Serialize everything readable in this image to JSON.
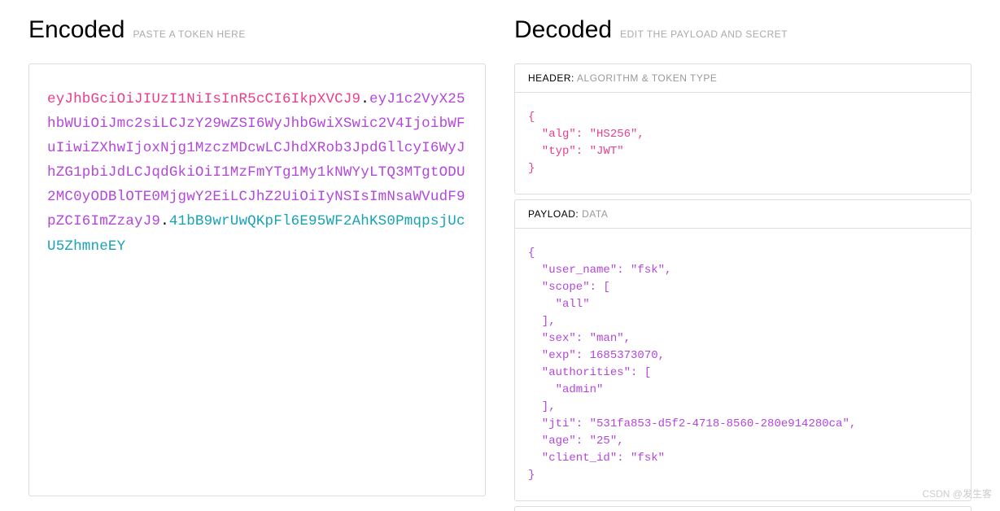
{
  "encoded": {
    "title": "Encoded",
    "subtitle": "PASTE A TOKEN HERE",
    "token": {
      "header": "eyJhbGciOiJIUzI1NiIsInR5cCI6IkpXVCJ9",
      "payload": "eyJ1c2VyX25hbWUiOiJmc2siLCJzY29wZSI6WyJhbGwiXSwic2V4IjoibWFuIiwiZXhwIjoxNjg1MzczMDcwLCJhdXRob3JpdGllcyI6WyJhZG1pbiJdLCJqdGkiOiI1MzFmYTg1My1kNWYyLTQ3MTgtODU2MC0yODBlOTE0MjgwY2EiLCJhZ2UiOiIyNSIsImNsaWVudF9pZCI6ImZzayJ9",
      "signature": "41bB9wrUwQKpFl6E95WF2AhKS0PmqpsjUcU5ZhmneEY"
    }
  },
  "decoded": {
    "title": "Decoded",
    "subtitle": "EDIT THE PAYLOAD AND SECRET",
    "header_section": {
      "label": "HEADER:",
      "sub": "ALGORITHM & TOKEN TYPE",
      "json": "{\n  \"alg\": \"HS256\",\n  \"typ\": \"JWT\"\n}"
    },
    "payload_section": {
      "label": "PAYLOAD:",
      "sub": "DATA",
      "json": "{\n  \"user_name\": \"fsk\",\n  \"scope\": [\n    \"all\"\n  ],\n  \"sex\": \"man\",\n  \"exp\": 1685373070,\n  \"authorities\": [\n    \"admin\"\n  ],\n  \"jti\": \"531fa853-d5f2-4718-8560-280e914280ca\",\n  \"age\": \"25\",\n  \"client_id\": \"fsk\"\n}"
    }
  },
  "watermark": "CSDN @发生客"
}
